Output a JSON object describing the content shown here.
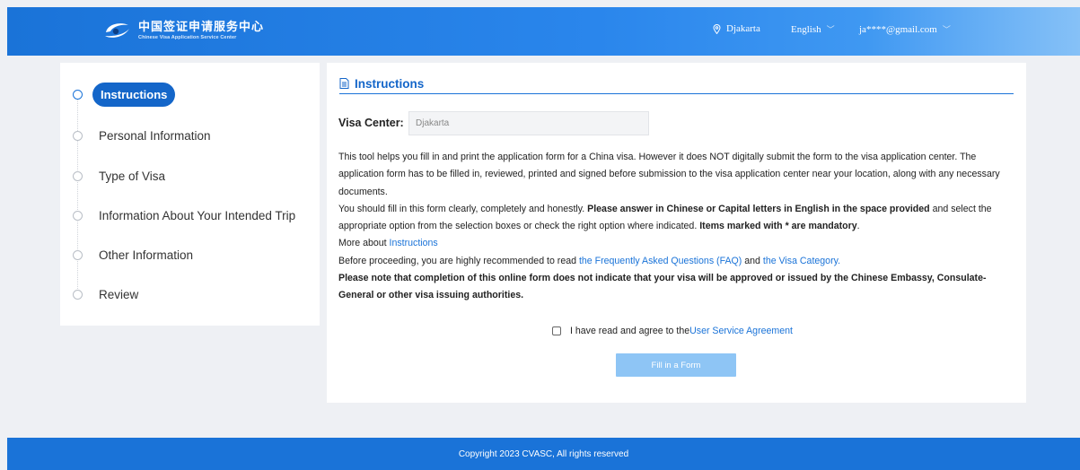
{
  "header": {
    "logo_cn": "中国签证申请服务中心",
    "logo_en": "Chinese Visa Application Service Center",
    "location": "Djakarta",
    "language": "English",
    "user_email": "ja****@gmail.com",
    "colors": {
      "primary": "#1a73d8",
      "accent": "#1466c9"
    }
  },
  "sidebar": {
    "steps": [
      {
        "label": "Instructions",
        "active": true
      },
      {
        "label": "Personal Information"
      },
      {
        "label": "Type of Visa"
      },
      {
        "label": "Information About Your Intended Trip"
      },
      {
        "label": "Other Information"
      },
      {
        "label": "Review"
      }
    ]
  },
  "main": {
    "title": "Instructions",
    "visa_center_label": "Visa Center:",
    "visa_center_value": "Djakarta",
    "para1": "This tool helps you fill in and print the application form for a China visa. However it does NOT digitally submit the form to the visa application center. The application form has to be filled in, reviewed, printed and signed before submission to the visa application center near your location, along with any necessary documents.",
    "para2_a": "You should fill in this form clearly, completely and honestly. ",
    "para2_b": "Please answer in Chinese or Capital letters in English in the space provided",
    "para2_c": " and select the appropriate option from the selection boxes or check the right option where indicated. ",
    "para2_d": "Items marked with * are mandatory",
    "para2_e": ".",
    "more_about": "More about ",
    "instructions_link": "Instructions",
    "before_text": "Before proceeding, you are highly recommended to read ",
    "faq_link": "the Frequently Asked Questions (FAQ)",
    "and_text": " and ",
    "category_link": "the Visa Category.",
    "note": "Please note that completion of this online form does not indicate that your visa will be approved or issued by the Chinese Embassy, Consulate-General or other visa issuing authorities.",
    "agree_text": "I have read and agree to the ",
    "agree_link": "User Service Agreement",
    "fill_button": "Fill in a Form"
  },
  "footer": {
    "copyright": "Copyright 2023 CVASC, All rights reserved"
  }
}
